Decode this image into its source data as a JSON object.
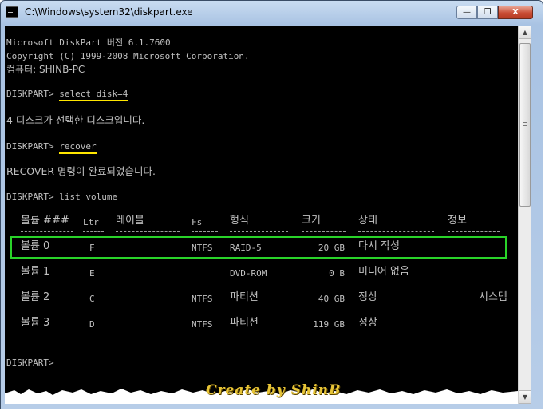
{
  "window": {
    "title": "C:\\Windows\\system32\\diskpart.exe",
    "minimize": "—",
    "maximize": "❐",
    "close": "X"
  },
  "console": {
    "header1": "Microsoft DiskPart 버전 6.1.7600",
    "header2": "Copyright (C) 1999-2008 Microsoft Corporation.",
    "header3": "컴퓨터: SHINB-PC",
    "prompt": "DISKPART> ",
    "cmd1": "select disk=4",
    "out1": "4 디스크가 선택한 디스크입니다.",
    "cmd2": "recover",
    "out2": "RECOVER 명령이 완료되었습니다.",
    "cmd3": "list volume",
    "final_prompt": "DISKPART>"
  },
  "volume_table": {
    "headers": [
      "볼륨 ###",
      "Ltr",
      "레이블",
      "Fs",
      "형식",
      "크기",
      "상태",
      "정보"
    ],
    "rows": [
      {
        "vol": "볼륨 0",
        "ltr": "F",
        "label": "",
        "fs": "NTFS",
        "type": "RAID-5",
        "size": "20 GB",
        "status": "다시 작성",
        "info": ""
      },
      {
        "vol": "볼륨 1",
        "ltr": "E",
        "label": "",
        "fs": "",
        "type": "DVD-ROM",
        "size": "0 B",
        "status": "미디어 없음",
        "info": ""
      },
      {
        "vol": "볼륨 2",
        "ltr": "C",
        "label": "",
        "fs": "NTFS",
        "type": "파티션",
        "size": "40 GB",
        "status": "정상",
        "info": "시스템"
      },
      {
        "vol": "볼륨 3",
        "ltr": "D",
        "label": "",
        "fs": "NTFS",
        "type": "파티션",
        "size": "119 GB",
        "status": "정상",
        "info": ""
      }
    ]
  },
  "watermark": "Create by ShinB",
  "colors": {
    "console_bg": "#000000",
    "console_text": "#c0c0c0",
    "highlight_underline": "#ffe600",
    "highlight_box": "#29d329",
    "watermark": "#e7c437"
  }
}
